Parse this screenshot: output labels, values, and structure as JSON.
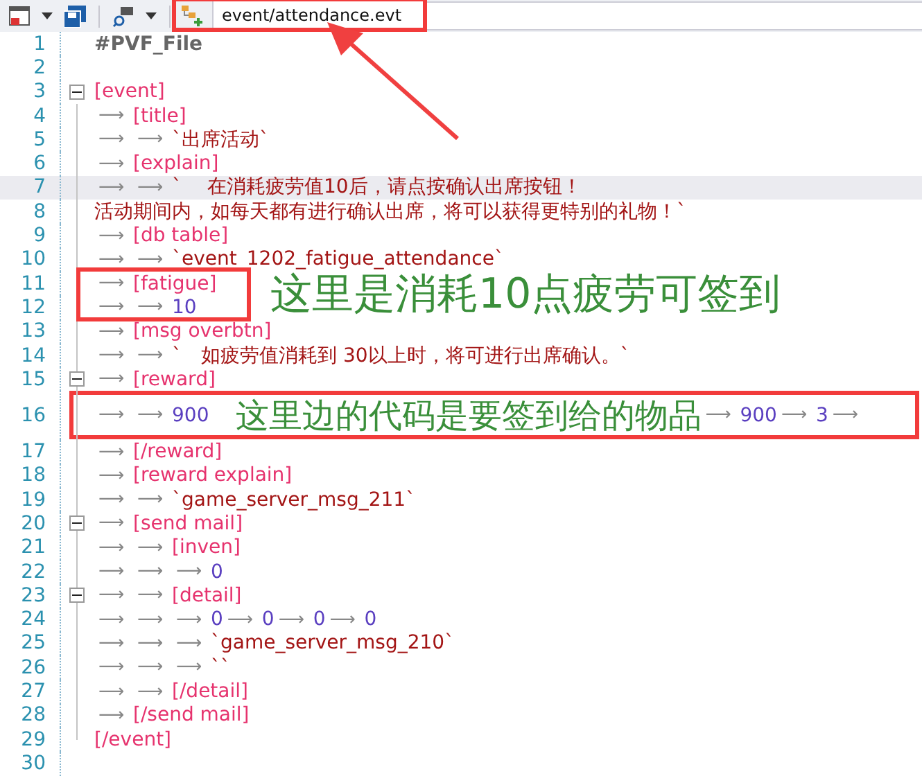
{
  "toolbar": {
    "path": "event/attendance.evt"
  },
  "lines": [
    {
      "number": "1",
      "selected": false,
      "fold": false,
      "tokens": [
        {
          "kind": "header",
          "text": "#PVF_File"
        }
      ]
    },
    {
      "number": "2",
      "selected": false,
      "fold": false
    },
    {
      "number": "3",
      "selected": false,
      "fold": true,
      "tokens": [
        {
          "kind": "section",
          "text": "[event]"
        }
      ]
    },
    {
      "number": "4",
      "selected": false,
      "fold": false,
      "tokens": [
        {
          "kind": "tab",
          "text": "⟶"
        },
        {
          "kind": "section",
          "text": "[title]"
        }
      ]
    },
    {
      "number": "5",
      "selected": false,
      "fold": false,
      "tokens": [
        {
          "kind": "tab",
          "text": "⟶"
        },
        {
          "kind": "tab",
          "text": "⟶"
        },
        {
          "kind": "string",
          "text": "`出席活动`"
        }
      ]
    },
    {
      "number": "6",
      "selected": false,
      "fold": false,
      "tokens": [
        {
          "kind": "tab",
          "text": "⟶"
        },
        {
          "kind": "section",
          "text": "[explain]"
        }
      ]
    },
    {
      "number": "7",
      "selected": true,
      "fold": false,
      "tokens": [
        {
          "kind": "tab",
          "text": "⟶"
        },
        {
          "kind": "tab",
          "text": "⟶"
        },
        {
          "kind": "string",
          "text": "`　 在消耗疲劳值10后，请点按确认出席按钮！"
        }
      ]
    },
    {
      "number": "8",
      "selected": false,
      "fold": false,
      "tokens": [
        {
          "kind": "string",
          "text": "活动期间内，如每天都有进行确认出席，将可以获得更特别的礼物！`"
        }
      ]
    },
    {
      "number": "9",
      "selected": false,
      "fold": false,
      "tokens": [
        {
          "kind": "tab",
          "text": "⟶"
        },
        {
          "kind": "section",
          "text": "[db table]"
        }
      ]
    },
    {
      "number": "10",
      "selected": false,
      "fold": false,
      "tokens": [
        {
          "kind": "tab",
          "text": "⟶"
        },
        {
          "kind": "tab",
          "text": "⟶"
        },
        {
          "kind": "string",
          "text": "`event_1202_fatigue_attendance`"
        }
      ]
    },
    {
      "number": "11",
      "selected": false,
      "fold": false,
      "tokens": [
        {
          "kind": "tab",
          "text": "⟶"
        },
        {
          "kind": "section",
          "text": "[fatigue]"
        }
      ]
    },
    {
      "number": "12",
      "selected": false,
      "fold": false,
      "tokens": [
        {
          "kind": "tab",
          "text": "⟶"
        },
        {
          "kind": "tab",
          "text": "⟶"
        },
        {
          "kind": "number",
          "text": "10"
        }
      ]
    },
    {
      "number": "13",
      "selected": false,
      "fold": false,
      "tokens": [
        {
          "kind": "tab",
          "text": "⟶"
        },
        {
          "kind": "section",
          "text": "[msg overbtn]"
        }
      ]
    },
    {
      "number": "14",
      "selected": false,
      "fold": false,
      "tokens": [
        {
          "kind": "tab",
          "text": "⟶"
        },
        {
          "kind": "tab",
          "text": "⟶"
        },
        {
          "kind": "string",
          "text": "`　如疲劳值消耗到 30以上时，将可进行出席确认。`"
        }
      ]
    },
    {
      "number": "15",
      "selected": false,
      "fold": true,
      "tokens": [
        {
          "kind": "tab",
          "text": "⟶"
        },
        {
          "kind": "section",
          "text": "[reward]"
        }
      ]
    },
    {
      "number": "16",
      "selected": false,
      "fold": false,
      "tokens": [
        {
          "kind": "tab",
          "text": "⟶"
        },
        {
          "kind": "tab",
          "text": "⟶"
        },
        {
          "kind": "number",
          "text": "900"
        },
        {
          "kind": "gap"
        },
        {
          "kind": "tab",
          "text": "⟶"
        },
        {
          "kind": "number",
          "text": "900"
        },
        {
          "kind": "tab",
          "text": "⟶"
        },
        {
          "kind": "number",
          "text": "3"
        },
        {
          "kind": "tab",
          "text": "⟶"
        }
      ]
    },
    {
      "number": "17",
      "selected": false,
      "fold": false,
      "tokens": [
        {
          "kind": "tab",
          "text": "⟶"
        },
        {
          "kind": "section",
          "text": "[/reward]"
        }
      ]
    },
    {
      "number": "18",
      "selected": false,
      "fold": false,
      "tokens": [
        {
          "kind": "tab",
          "text": "⟶"
        },
        {
          "kind": "section",
          "text": "[reward explain]"
        }
      ]
    },
    {
      "number": "19",
      "selected": false,
      "fold": false,
      "tokens": [
        {
          "kind": "tab",
          "text": "⟶"
        },
        {
          "kind": "tab",
          "text": "⟶"
        },
        {
          "kind": "string",
          "text": "`game_server_msg_211`"
        }
      ]
    },
    {
      "number": "20",
      "selected": false,
      "fold": true,
      "tokens": [
        {
          "kind": "tab",
          "text": "⟶"
        },
        {
          "kind": "section",
          "text": "[send mail]"
        }
      ]
    },
    {
      "number": "21",
      "selected": false,
      "fold": false,
      "tokens": [
        {
          "kind": "tab",
          "text": "⟶"
        },
        {
          "kind": "tab",
          "text": "⟶"
        },
        {
          "kind": "section",
          "text": "[inven]"
        }
      ]
    },
    {
      "number": "22",
      "selected": false,
      "fold": false,
      "tokens": [
        {
          "kind": "tab",
          "text": "⟶"
        },
        {
          "kind": "tab",
          "text": "⟶"
        },
        {
          "kind": "tab",
          "text": "⟶"
        },
        {
          "kind": "number",
          "text": "0"
        }
      ]
    },
    {
      "number": "23",
      "selected": false,
      "fold": true,
      "tokens": [
        {
          "kind": "tab",
          "text": "⟶"
        },
        {
          "kind": "tab",
          "text": "⟶"
        },
        {
          "kind": "section",
          "text": "[detail]"
        }
      ]
    },
    {
      "number": "24",
      "selected": false,
      "fold": false,
      "tokens": [
        {
          "kind": "tab",
          "text": "⟶"
        },
        {
          "kind": "tab",
          "text": "⟶"
        },
        {
          "kind": "tab",
          "text": "⟶"
        },
        {
          "kind": "number",
          "text": "0"
        },
        {
          "kind": "tab",
          "text": "⟶"
        },
        {
          "kind": "number",
          "text": "0"
        },
        {
          "kind": "tab",
          "text": "⟶"
        },
        {
          "kind": "number",
          "text": "0"
        },
        {
          "kind": "tab",
          "text": "⟶"
        },
        {
          "kind": "number",
          "text": "0"
        }
      ]
    },
    {
      "number": "25",
      "selected": false,
      "fold": false,
      "tokens": [
        {
          "kind": "tab",
          "text": "⟶"
        },
        {
          "kind": "tab",
          "text": "⟶"
        },
        {
          "kind": "tab",
          "text": "⟶"
        },
        {
          "kind": "string",
          "text": "`game_server_msg_210`"
        }
      ]
    },
    {
      "number": "26",
      "selected": false,
      "fold": false,
      "tokens": [
        {
          "kind": "tab",
          "text": "⟶"
        },
        {
          "kind": "tab",
          "text": "⟶"
        },
        {
          "kind": "tab",
          "text": "⟶"
        },
        {
          "kind": "string",
          "text": "``"
        }
      ]
    },
    {
      "number": "27",
      "selected": false,
      "fold": false,
      "tokens": [
        {
          "kind": "tab",
          "text": "⟶"
        },
        {
          "kind": "tab",
          "text": "⟶"
        },
        {
          "kind": "section",
          "text": "[/detail]"
        }
      ]
    },
    {
      "number": "28",
      "selected": false,
      "fold": false,
      "tokens": [
        {
          "kind": "tab",
          "text": "⟶"
        },
        {
          "kind": "section",
          "text": "[/send mail]"
        }
      ]
    },
    {
      "number": "29",
      "selected": false,
      "fold": false,
      "tokens": [
        {
          "kind": "section",
          "text": "[/event]"
        }
      ]
    },
    {
      "number": "30",
      "selected": false,
      "fold": false
    }
  ],
  "annotations": [
    {
      "text": "这里是消耗10点疲劳可签到"
    },
    {
      "text": "这里边的代码是要签到给的物品"
    }
  ]
}
